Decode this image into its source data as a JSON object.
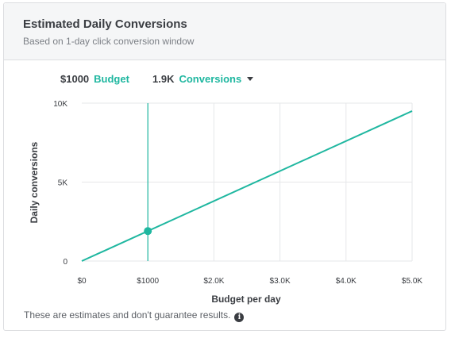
{
  "header": {
    "title": "Estimated Daily Conversions",
    "subtitle": "Based on 1-day click conversion window"
  },
  "summary": {
    "budget_value": "$1000",
    "budget_label": "Budget",
    "conversions_value": "1.9K",
    "conversions_label": "Conversions"
  },
  "footer": {
    "note": "These are estimates and don't guarantee results."
  },
  "colors": {
    "accent": "#1fb7a0",
    "grid": "#e6e7e9",
    "text": "#3a3d42"
  },
  "icons": {
    "info": "info-icon",
    "dropdown": "chevron-down-icon"
  },
  "chart_data": {
    "type": "line",
    "xlabel": "Budget per day",
    "ylabel": "Daily conversions",
    "xlim": [
      0,
      5000
    ],
    "ylim": [
      0,
      10000
    ],
    "x_ticks": [
      0,
      1000,
      2000,
      3000,
      4000,
      5000
    ],
    "x_tick_labels": [
      "$0",
      "$1000",
      "$2.0K",
      "$3.0K",
      "$4.0K",
      "$5.0K"
    ],
    "y_ticks": [
      0,
      5000,
      10000
    ],
    "y_tick_labels": [
      "0",
      "5K",
      "10K"
    ],
    "grid": true,
    "series": [
      {
        "x": [
          0,
          5000
        ],
        "y": [
          0,
          9500
        ]
      }
    ],
    "selected_point": {
      "x": 1000,
      "y": 1900
    }
  }
}
